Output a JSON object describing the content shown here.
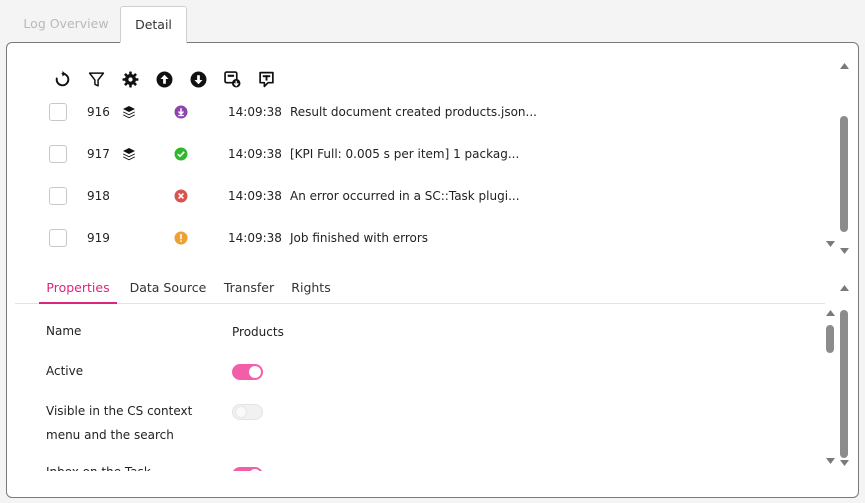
{
  "tabs": {
    "log_overview": "Log Overview",
    "detail": "Detail"
  },
  "toolbar": {
    "buttons": [
      "refresh-icon",
      "filter-icon",
      "gear-icon",
      "arrow-up-circle-icon",
      "arrow-down-circle-icon",
      "export-icon",
      "import-icon"
    ]
  },
  "log": {
    "rows": [
      {
        "id": "916",
        "time": "14:09:38",
        "message": "Result document created products.json...",
        "status": "download",
        "status_color": "#8e44ad",
        "stack": true
      },
      {
        "id": "917",
        "time": "14:09:38",
        "message": "[KPI Full: 0.005 s per item] 1 packag...",
        "status": "success",
        "status_color": "#2eb82e",
        "stack": true
      },
      {
        "id": "918",
        "time": "14:09:38",
        "message": "An error occurred in a SC::Task plugi...",
        "status": "error",
        "status_color": "#d9534f",
        "stack": false
      },
      {
        "id": "919",
        "time": "14:09:38",
        "message": "Job finished with errors",
        "status": "warning",
        "status_color": "#f0a030",
        "stack": false
      }
    ]
  },
  "property_tabs": {
    "properties": "Properties",
    "data_source": "Data Source",
    "transfer": "Transfer",
    "rights": "Rights"
  },
  "properties": {
    "name_label": "Name",
    "name_value": "Products",
    "active_label": "Active",
    "active_on": true,
    "visible_label_line1": "Visible in the CS context",
    "visible_label_line2": "menu and the search",
    "visible_on": false,
    "partial_label": "Inbox on the Task",
    "partial_on": true
  },
  "colors": {
    "accent": "#d9277d",
    "toggle_on": "#f25fa8"
  }
}
